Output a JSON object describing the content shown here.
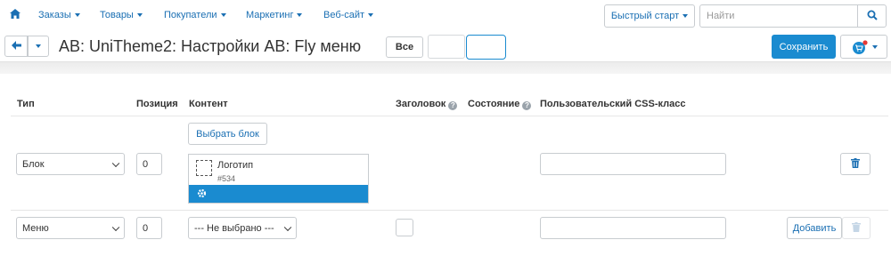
{
  "nav": {
    "items": [
      "Заказы",
      "Товары",
      "Покупатели",
      "Маркетинг",
      "Веб-сайт"
    ],
    "quick_start": "Быстрый старт",
    "search_placeholder": "Найти"
  },
  "header": {
    "title": "AB: UniTheme2: Настройки AB: Fly меню",
    "filter_all": "Все",
    "save_label": "Сохранить"
  },
  "table": {
    "columns": {
      "type": "Тип",
      "position": "Позиция",
      "content": "Контент",
      "heading": "Заголовок",
      "status": "Состояние",
      "css_class": "Пользовательский CSS-класс"
    },
    "choose_block_label": "Выбрать блок",
    "rows": [
      {
        "type": "Блок",
        "position": "0",
        "block_name": "Логотип",
        "block_id": "#534",
        "css_class": ""
      },
      {
        "type": "Меню",
        "position": "0",
        "content_select": "--- Не выбрано ---",
        "css_class": "",
        "add_label": "Добавить"
      }
    ]
  },
  "colors": {
    "accent": "#1a8bd0",
    "link": "#1a6fb3"
  }
}
